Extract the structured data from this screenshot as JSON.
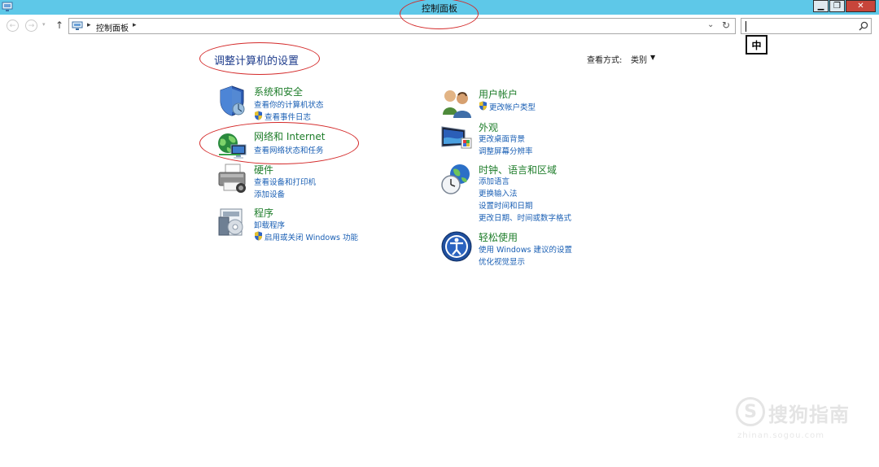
{
  "window": {
    "title": "控制面板",
    "minimize_glyph": "▁",
    "maximize_glyph": "❐",
    "close_glyph": "✕"
  },
  "nav": {
    "back_glyph": "←",
    "forward_glyph": "→",
    "history_glyph": "▾",
    "up_glyph": "↑",
    "breadcrumb_sep": "▸",
    "breadcrumb": [
      "控制面板"
    ],
    "dropdown_glyph": "⌄",
    "refresh_glyph": "↻"
  },
  "search": {
    "value": "",
    "placeholder": ""
  },
  "ime": {
    "label": "中"
  },
  "main": {
    "heading": "调整计算机的设置",
    "view_by_label": "查看方式:",
    "view_by_value": "类别",
    "view_by_caret": "▼"
  },
  "categories": [
    {
      "title": "系统和安全",
      "icon": "shield-icon",
      "links": [
        "查看你的计算机状态",
        "查看事件日志"
      ],
      "shield_links": [
        false,
        true
      ]
    },
    {
      "title": "网络和 Internet",
      "icon": "network-globe-icon",
      "links": [
        "查看网络状态和任务"
      ],
      "shield_links": [
        false
      ]
    },
    {
      "title": "硬件",
      "icon": "printer-icon",
      "links": [
        "查看设备和打印机",
        "添加设备"
      ],
      "shield_links": [
        false,
        false
      ]
    },
    {
      "title": "程序",
      "icon": "programs-icon",
      "links": [
        "卸载程序",
        "启用或关闭 Windows 功能"
      ],
      "shield_links": [
        false,
        true
      ]
    },
    {
      "title": "用户帐户",
      "icon": "users-icon",
      "links": [
        "更改帐户类型"
      ],
      "shield_links": [
        true
      ]
    },
    {
      "title": "外观",
      "icon": "appearance-icon",
      "links": [
        "更改桌面背景",
        "调整屏幕分辨率"
      ],
      "shield_links": [
        false,
        false
      ]
    },
    {
      "title": "时钟、语言和区域",
      "icon": "clock-globe-icon",
      "links": [
        "添加语言",
        "更换输入法",
        "设置时间和日期",
        "更改日期、时间或数字格式"
      ],
      "shield_links": [
        false,
        false,
        false,
        false
      ]
    },
    {
      "title": "轻松使用",
      "icon": "ease-of-access-icon",
      "links": [
        "使用 Windows 建议的设置",
        "优化视觉显示"
      ],
      "shield_links": [
        false,
        false
      ]
    }
  ],
  "watermark": {
    "glyph": "S",
    "text": "搜狗指南",
    "url": "zhinan.sogou.com"
  },
  "colors": {
    "titlebar": "#5ec8e8",
    "category_title": "#1e7d2a",
    "link": "#1a5fb4",
    "heading": "#1e3c8c",
    "annotation": "#d42a2a"
  }
}
